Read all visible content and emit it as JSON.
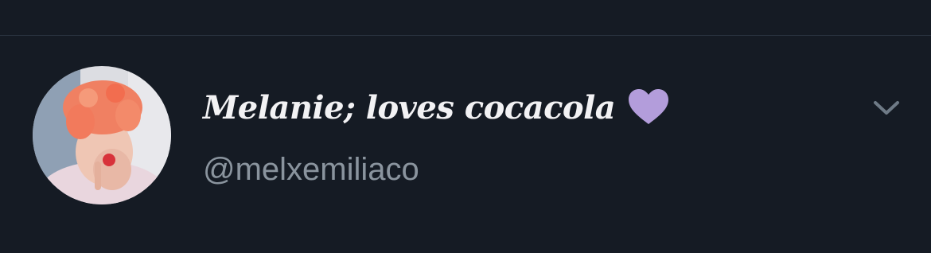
{
  "tweet_header": {
    "display_name": "Melanie; loves cocacola",
    "heart_emoji": "purple-heart",
    "handle": "@melxemiliaco",
    "menu_icon": "chevron-down-icon"
  },
  "colors": {
    "background": "#151b24",
    "divider": "#2a333f",
    "display_name": "#f2f2f4",
    "handle": "#8a949e",
    "heart": "#b39ddb",
    "chevron": "#6e7a86"
  }
}
